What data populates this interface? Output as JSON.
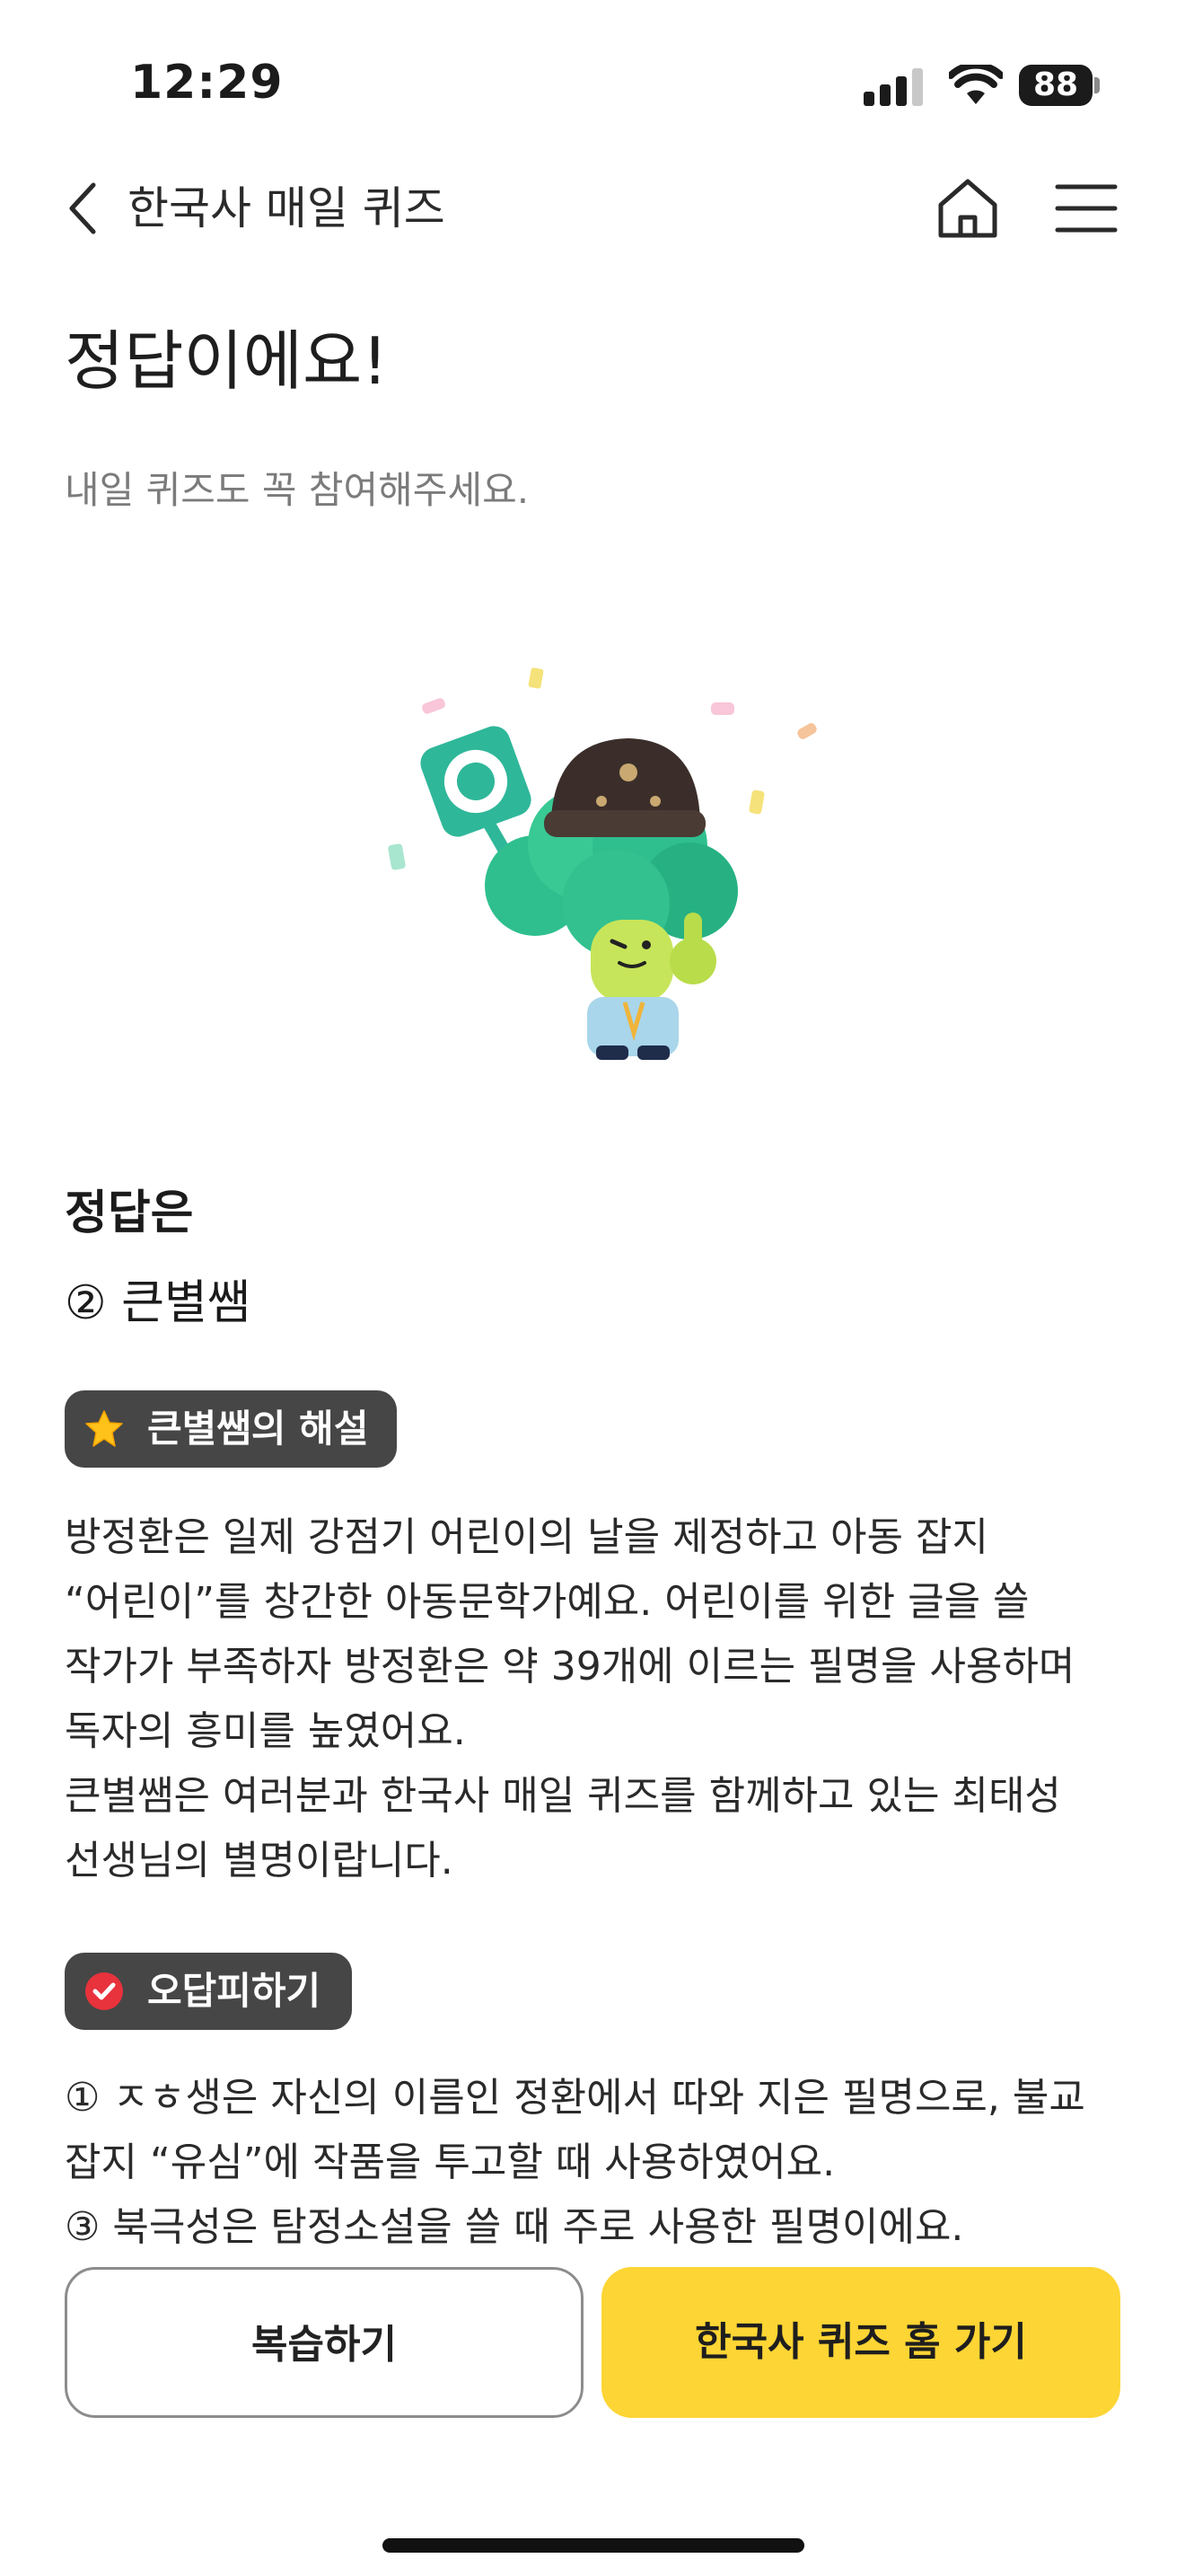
{
  "status_bar": {
    "time": "12:29",
    "battery_level": "88"
  },
  "nav": {
    "title": "한국사 매일 퀴즈",
    "back_icon": "chevron-left-icon",
    "home_icon": "home-icon",
    "menu_icon": "hamburger-menu-icon"
  },
  "result": {
    "title": "정답이에요!",
    "subtitle": "내일 퀴즈도 꼭 참여해주세요."
  },
  "illustration": {
    "badge_glyph": "O"
  },
  "answer": {
    "label": "정답은",
    "value": "② 큰별쌤"
  },
  "explanation": {
    "badge_label": "큰별쌤의 해설",
    "badge_icon": "star-icon",
    "lines": [
      "방정환은 일제 강점기 어린이의 날을 제정하고 아동 잡지",
      "“어린이”를 창간한 아동문학가예요. 어린이를 위한 글을 쓸",
      "작가가 부족하자 방정환은 약 39개에 이르는 필명을 사용하며",
      "독자의 흥미를 높였어요.",
      "큰별쌤은 여러분과 한국사 매일 퀴즈를 함께하고 있는 최태성",
      "선생님의 별명이랍니다."
    ]
  },
  "wrong_answers": {
    "badge_label": "오답피하기",
    "badge_icon": "check-circle-icon",
    "lines": [
      "① ㅈㅎ생은 자신의 이름인 정환에서 따와 지은 필명으로, 불교",
      "잡지 “유심”에 작품을 투고할 때 사용하였어요.",
      "③ 북극성은 탐정소설을 쓸 때 주로 사용한 필명이에요."
    ]
  },
  "buttons": {
    "review": "복습하기",
    "quiz_home": "한국사 퀴즈 홈 가기"
  },
  "colors": {
    "accent_yellow": "#fdd534",
    "badge_bg": "#464646",
    "teal": "#2fb79a"
  }
}
